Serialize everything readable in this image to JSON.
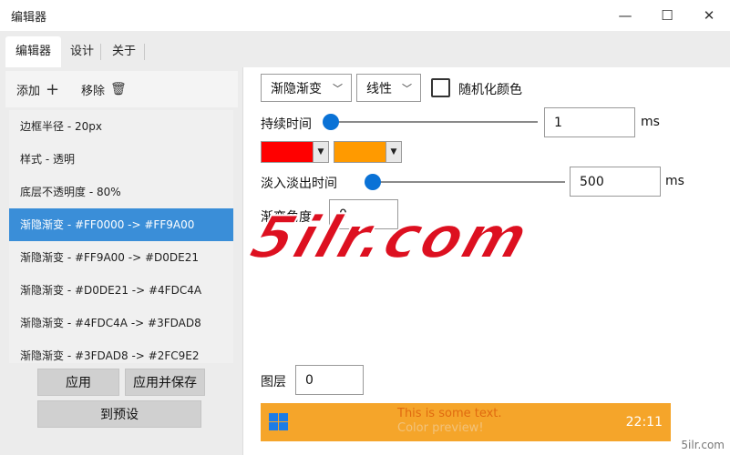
{
  "window": {
    "title": "编辑器",
    "min": "—",
    "max": "☐",
    "close": "✕"
  },
  "tabs": [
    {
      "label": "编辑器"
    },
    {
      "label": "设计"
    },
    {
      "label": "关于"
    }
  ],
  "toolbar": {
    "add_label": "添加",
    "add_icon": "+",
    "remove_label": "移除",
    "remove_icon": "🗑"
  },
  "effects": [
    "边框半径 - 20px",
    "样式 - 透明",
    "底层不透明度 - 80%",
    "渐隐渐变 - #FF0000 -> #FF9A00",
    "渐隐渐变 - #FF9A00 -> #D0DE21",
    "渐隐渐变 - #D0DE21 -> #4FDC4A",
    "渐隐渐变 - #4FDC4A -> #3FDAD8",
    "渐隐渐变 - #3FDAD8 -> #2FC9E2"
  ],
  "selected_index": 3,
  "buttons": {
    "apply": "应用",
    "apply_save": "应用并保存",
    "to_preset": "到预设"
  },
  "editor": {
    "mode": "渐隐渐变",
    "curve": "线性",
    "randomize_label": "随机化颜色",
    "randomize_checked": false,
    "duration_label": "持续时间",
    "duration_value": "1",
    "duration_unit": "ms",
    "color1": "#FF0000",
    "color2": "#FF9A00",
    "fade_label": "淡入淡出时间",
    "fade_value": "500",
    "fade_unit": "ms",
    "angle_label": "渐变角度",
    "angle_value": "0",
    "layer_label": "图层",
    "layer_value": "0"
  },
  "preview": {
    "line1": "This is some text.",
    "line2": "Color preview!",
    "clock": "22:11",
    "background": "#F5A52A"
  },
  "watermark": {
    "text": "5ilr.com",
    "corner": "5ilr.com"
  },
  "colors": {
    "accent": "#3A8ED8",
    "slider": "#0A72D6",
    "watermark": "#DD1020"
  }
}
